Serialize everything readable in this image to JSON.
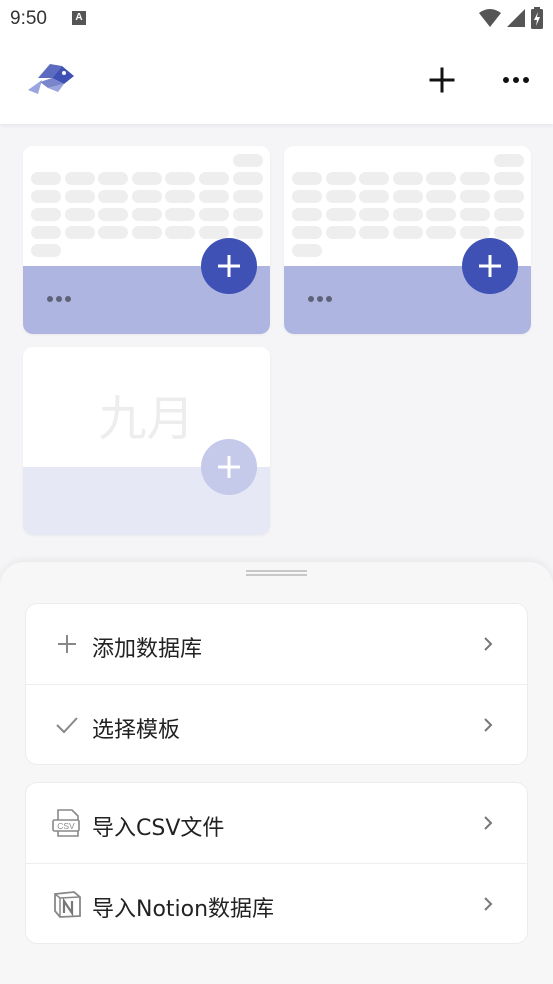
{
  "status_bar": {
    "time": "9:50",
    "notification_icon": "A",
    "icons": [
      "wifi-icon",
      "signal-icon",
      "battery-charging-icon"
    ]
  },
  "app_bar": {
    "logo_icon": "fish-logo-icon",
    "add_icon": "plus-icon",
    "more_icon": "more-horizontal-icon"
  },
  "cards": [
    {
      "type": "calendar-grid",
      "accent": "#adb5e0"
    },
    {
      "type": "calendar-grid",
      "accent": "#adb5e0"
    },
    {
      "type": "month",
      "month_label": "九月",
      "accent": "#e6e8f5"
    }
  ],
  "sheet": {
    "group1": [
      {
        "icon": "plus-icon",
        "label": "添加数据库"
      },
      {
        "icon": "check-icon",
        "label": "选择模板"
      }
    ],
    "group2": [
      {
        "icon": "csv-file-icon",
        "label": "导入CSV文件"
      },
      {
        "icon": "notion-icon",
        "label": "导入Notion数据库"
      }
    ]
  },
  "colors": {
    "primary": "#3f51b5",
    "card_accent": "#adb5e0",
    "card_accent_faded": "#e6e8f5"
  }
}
